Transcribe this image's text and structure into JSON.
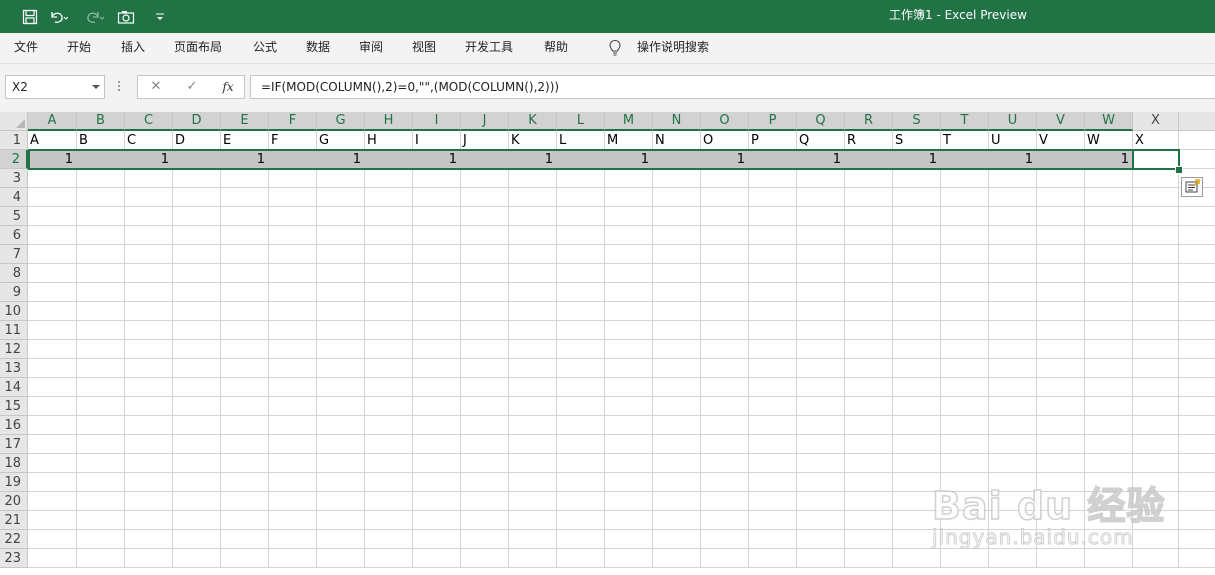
{
  "window": {
    "title": "工作簿1  -  Excel Preview"
  },
  "ribbon_tabs": [
    "文件",
    "开始",
    "插入",
    "页面布局",
    "公式",
    "数据",
    "审阅",
    "视图",
    "开发工具",
    "帮助"
  ],
  "tell_me": {
    "label": "操作说明搜索",
    "icon": "lightbulb-icon"
  },
  "quick_access": [
    "save-icon",
    "undo-icon",
    "redo-icon",
    "camera-icon",
    "customize-icon"
  ],
  "name_box": {
    "value": "X2"
  },
  "formula_bar": {
    "value": "=IF(MOD(COLUMN(),2)=0,\"\",(MOD(COLUMN(),2)))",
    "fx_label": "fx"
  },
  "columns": [
    "A",
    "B",
    "C",
    "D",
    "E",
    "F",
    "G",
    "H",
    "I",
    "J",
    "K",
    "L",
    "M",
    "N",
    "O",
    "P",
    "Q",
    "R",
    "S",
    "T",
    "U",
    "V",
    "W",
    "X"
  ],
  "rows": [
    "1",
    "2",
    "3",
    "4",
    "5",
    "6",
    "7",
    "8",
    "9",
    "10",
    "11",
    "12",
    "13",
    "14",
    "15",
    "16",
    "17",
    "18",
    "19",
    "20",
    "21",
    "22",
    "23"
  ],
  "row1_values": [
    "A",
    "B",
    "C",
    "D",
    "E",
    "F",
    "G",
    "H",
    "I",
    "J",
    "K",
    "L",
    "M",
    "N",
    "O",
    "P",
    "Q",
    "R",
    "S",
    "T",
    "U",
    "V",
    "W",
    "X"
  ],
  "row2_values": [
    "1",
    "",
    "1",
    "",
    "1",
    "",
    "1",
    "",
    "1",
    "",
    "1",
    "",
    "1",
    "",
    "1",
    "",
    "1",
    "",
    "1",
    "",
    "1",
    "",
    "1",
    ""
  ],
  "watermark": {
    "text": "Bai du 经验",
    "sub": "jingyan.baidu.com"
  },
  "colors": {
    "accent": "#217346",
    "selection": "#c6c6c6"
  }
}
